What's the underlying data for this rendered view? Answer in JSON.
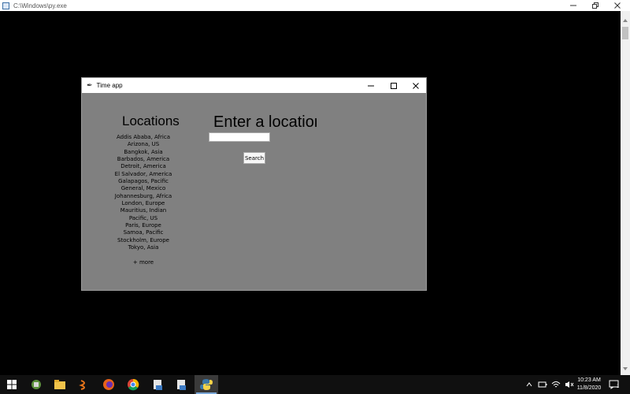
{
  "console": {
    "title": "C:\\Windows\\py.exe"
  },
  "app": {
    "title": "Time app",
    "locations_heading": "Locations",
    "locations": [
      "Addis Ababa, Africa",
      "Arizona, US",
      "Bangkok, Asia",
      "Barbados, America",
      "Detroit, America",
      "El Salvador, America",
      "Galapagos, Pacific",
      "General, Mexico",
      "Johannesburg, Africa",
      "London, Europe",
      "Mauritius, Indian",
      "Pacific, US",
      "Paris, Europe",
      "Samoa, Pacific",
      "Stockholm, Europe",
      "Tokyo, Asia"
    ],
    "more_label": "+ more",
    "prompt": "Enter a location",
    "input_value": "",
    "search_label": "Search",
    "background_color": "#808080"
  },
  "taskbar": {
    "apps": [
      "windows-start",
      "app-1",
      "file-explorer",
      "app-3",
      "firefox",
      "chrome",
      "app-6",
      "app-7",
      "python"
    ],
    "clock_time": "10:23 AM",
    "clock_date": "11/8/2020",
    "notification_badge": "1"
  }
}
